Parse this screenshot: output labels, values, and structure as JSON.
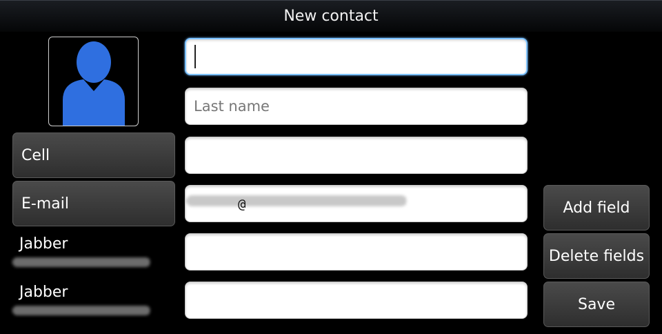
{
  "title": "New contact",
  "avatar": {
    "icon": "person-silhouette-icon",
    "color": "#2f6fe0"
  },
  "labels": [
    {
      "text": "Cell"
    },
    {
      "text": "E-mail"
    }
  ],
  "static_labels": [
    {
      "text": "Jabber"
    },
    {
      "text": "Jabber"
    }
  ],
  "fields": {
    "first_name": {
      "value": ""
    },
    "last_name": {
      "placeholder": "Last name"
    },
    "cell": {
      "value": ""
    },
    "email": {
      "visible_char": "@"
    },
    "jabber_1": {
      "value": ""
    },
    "jabber_2": {
      "value": ""
    }
  },
  "buttons": {
    "add_field": "Add field",
    "delete_fields": "Delete fields",
    "save": "Save"
  }
}
